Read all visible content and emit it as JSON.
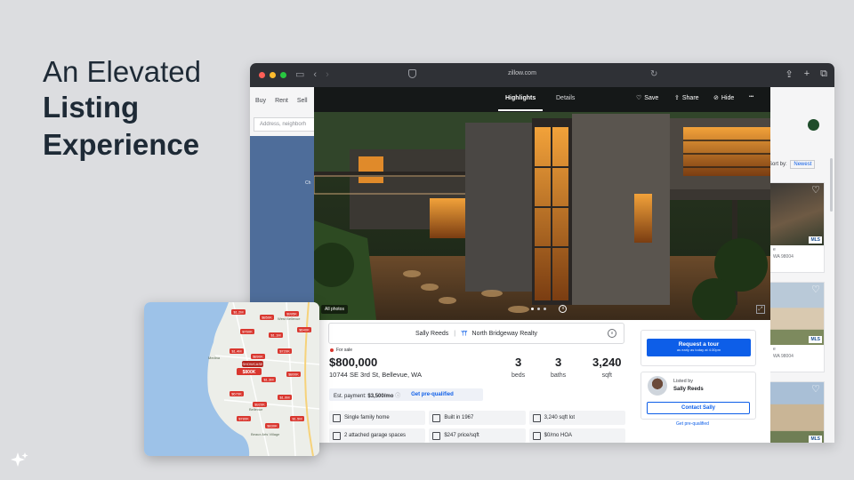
{
  "headline": {
    "line1": "An Elevated",
    "line2": "Listing",
    "line3": "Experience"
  },
  "browser": {
    "url": "zillow.com",
    "traffic_lights": [
      "#ff5f57",
      "#febc2e",
      "#28c840"
    ]
  },
  "background_page": {
    "nav": [
      "Buy",
      "Rent",
      "Sell"
    ],
    "search_placeholder": "Address, neighborh",
    "map_label": "Ch",
    "sort_label": "Sort by:",
    "sort_value": "Newest",
    "cards": [
      {
        "title": "e",
        "address": "WA 98004",
        "mls": "MLS"
      },
      {
        "title": "e",
        "address": "WA 98004",
        "mls": "MLS"
      },
      {
        "mls": "MLS"
      }
    ]
  },
  "photo_header": {
    "tabs": [
      "Highlights",
      "Details"
    ],
    "actions": {
      "save": "Save",
      "share": "Share",
      "hide": "Hide",
      "more": "•••"
    },
    "all_photos": "All photos"
  },
  "listing": {
    "agent_name": "Sally Reeds",
    "brokerage": "North Bridgeway Realty",
    "status": "For sale",
    "price": "$800,000",
    "address": "10744 SE 3rd St, Bellevue, WA",
    "beds": {
      "value": "3",
      "unit": "beds"
    },
    "baths": {
      "value": "3",
      "unit": "baths"
    },
    "sqft": {
      "value": "3,240",
      "unit": "sqft"
    },
    "est_payment_label": "Est. payment:",
    "est_payment_value": "$3,500/mo",
    "prequal_link": "Get pre-qualified",
    "facts": [
      {
        "icon": "house-icon",
        "label": "Single family home"
      },
      {
        "icon": "hammer-icon",
        "label": "Built in 1967"
      },
      {
        "icon": "ruler-icon",
        "label": "3,240 sqft lot"
      },
      {
        "icon": "garage-icon",
        "label": "2 attached garage spaces"
      },
      {
        "icon": "tag-icon",
        "label": "$247 price/sqft"
      },
      {
        "icon": "hoa-icon",
        "label": "$0/mo HOA"
      }
    ]
  },
  "sidebar": {
    "tour_button": "Request a tour",
    "tour_sub": "as early as today at 4:30pm",
    "listed_by": "Listed by",
    "agent": "Sally Reeds",
    "contact_button": "Contact Sally",
    "prequal": "Get pre-qualified"
  },
  "map_inset": {
    "pins": [
      "$1.2M",
      "$850K",
      "$995K",
      "$760K",
      "$1.1M",
      "$640K",
      "$1.4M",
      "$890K",
      "$720K",
      "$980K",
      "$1.3M",
      "$800K",
      "$670K",
      "$920K",
      "$1.0M",
      "$780K",
      "$830K",
      "$1.5M"
    ],
    "featured_pin_top": "SHOWCASE",
    "featured_pin_value": "$800K",
    "place_labels": [
      "Bellevue",
      "Medina",
      "West Bellevue",
      "Beaux Arts Village"
    ]
  }
}
